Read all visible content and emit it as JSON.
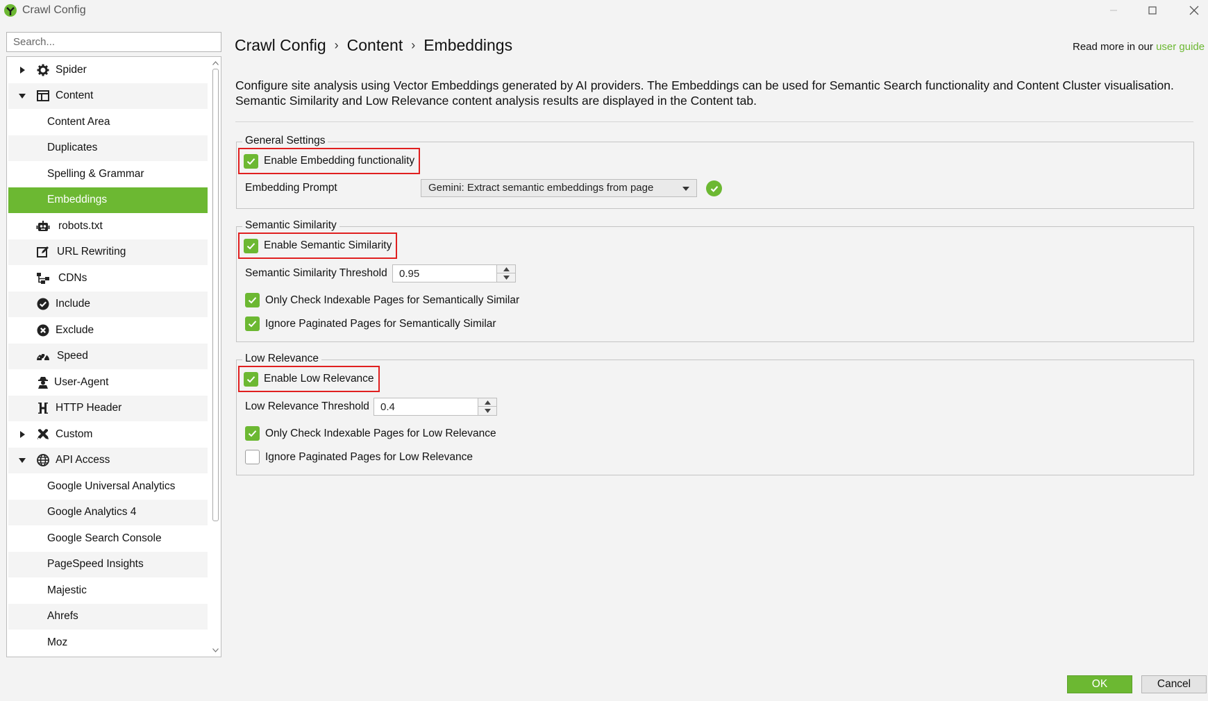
{
  "window": {
    "title": "Crawl Config",
    "minimize_icon": "minimize-icon",
    "maximize_icon": "maximize-icon",
    "close_icon": "close-icon"
  },
  "search": {
    "placeholder": "Search..."
  },
  "sidebar": {
    "items": [
      {
        "label": "Spider",
        "icon": "gear-icon",
        "expander": "collapsed"
      },
      {
        "label": "Content",
        "icon": "layout-icon",
        "expander": "expanded"
      },
      {
        "label": "Content Area"
      },
      {
        "label": "Duplicates"
      },
      {
        "label": "Spelling & Grammar"
      },
      {
        "label": "Embeddings",
        "selected": true
      },
      {
        "label": "robots.txt",
        "icon": "robot-icon"
      },
      {
        "label": "URL Rewriting",
        "icon": "edit-icon"
      },
      {
        "label": "CDNs",
        "icon": "network-icon"
      },
      {
        "label": "Include",
        "icon": "check-circle-icon"
      },
      {
        "label": "Exclude",
        "icon": "x-circle-icon"
      },
      {
        "label": "Speed",
        "icon": "speedometer-icon"
      },
      {
        "label": "User-Agent",
        "icon": "user-agent-icon"
      },
      {
        "label": "HTTP Header",
        "icon": "header-icon"
      },
      {
        "label": "Custom",
        "icon": "tools-icon",
        "expander": "collapsed"
      },
      {
        "label": "API Access",
        "icon": "globe-icon",
        "expander": "expanded"
      },
      {
        "label": "Google Universal Analytics"
      },
      {
        "label": "Google Analytics 4"
      },
      {
        "label": "Google Search Console"
      },
      {
        "label": "PageSpeed Insights"
      },
      {
        "label": "Majestic"
      },
      {
        "label": "Ahrefs"
      },
      {
        "label": "Moz"
      }
    ]
  },
  "header": {
    "breadcrumb": [
      "Crawl Config",
      "Content",
      "Embeddings"
    ],
    "breadcrumb_sep": "›",
    "read_more_prefix": "Read more in our ",
    "read_more_link": "user guide"
  },
  "description": "Configure site analysis using Vector Embeddings generated by AI providers. The Embeddings can be used for Semantic Search functionality and Content Cluster visualisation. Semantic Similarity and Low Relevance content analysis results are displayed in the Content tab.",
  "general": {
    "legend": "General Settings",
    "enable_label": "Enable Embedding functionality",
    "enable_checked": true,
    "prompt_label": "Embedding Prompt",
    "prompt_value": "Gemini: Extract semantic embeddings from page",
    "prompt_status_icon": "check-circle-icon"
  },
  "semantic": {
    "legend": "Semantic Similarity",
    "enable_label": "Enable Semantic Similarity",
    "enable_checked": true,
    "threshold_label": "Semantic Similarity Threshold",
    "threshold_value": "0.95",
    "indexable_label": "Only Check Indexable Pages for Semantically Similar",
    "indexable_checked": true,
    "paginated_label": "Ignore Paginated Pages for Semantically Similar",
    "paginated_checked": true
  },
  "low": {
    "legend": "Low Relevance",
    "enable_label": "Enable Low Relevance",
    "enable_checked": true,
    "threshold_label": "Low Relevance Threshold",
    "threshold_value": "0.4",
    "indexable_label": "Only Check Indexable Pages for Low Relevance",
    "indexable_checked": true,
    "paginated_label": "Ignore Paginated Pages for Low Relevance",
    "paginated_checked": false
  },
  "footer": {
    "ok": "OK",
    "cancel": "Cancel"
  },
  "colors": {
    "accent": "#6cb832",
    "highlight": "#e01f1f"
  }
}
